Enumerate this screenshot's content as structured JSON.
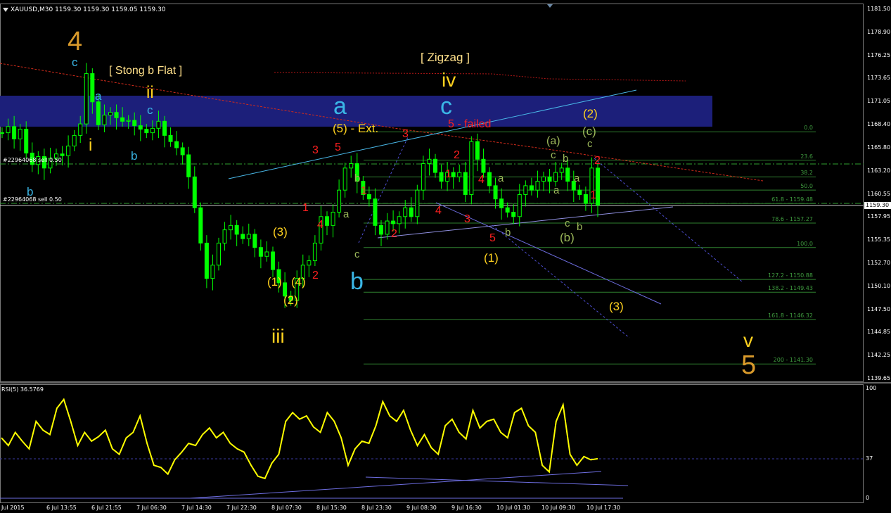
{
  "header": {
    "symbol_line": "XAUUSD,M30 1159.30 1159.30 1159.05 1159.30"
  },
  "price_axis": {
    "ticks": [
      "1181.50",
      "1178.90",
      "1176.25",
      "1173.65",
      "1171.05",
      "1168.40",
      "1165.80",
      "1163.20",
      "1160.55",
      "1157.95",
      "1155.35",
      "1152.70",
      "1150.10",
      "1147.50",
      "1144.85",
      "1142.25",
      "1139.65"
    ],
    "current_price": "1159.30"
  },
  "time_axis": {
    "ticks": [
      "Jul 2015",
      "6 Jul 13:55",
      "6 Jul 21:55",
      "7 Jul 06:30",
      "7 Jul 14:30",
      "7 Jul 22:30",
      "8 Jul 07:30",
      "8 Jul 15:30",
      "8 Jul 23:30",
      "9 Jul 08:30",
      "9 Jul 16:30",
      "10 Jul 01:30",
      "10 Jul 09:30",
      "10 Jul 17:30"
    ]
  },
  "orders": {
    "order1": "#22964068 sell 0.50",
    "order2": "#22964068 sell 0.50"
  },
  "fib_levels": [
    "0.0",
    "23.6",
    "38.2",
    "50.0",
    "61.8 - 1159.48",
    "78.6 - 1157.27",
    "100.0",
    "127.2 - 1150.88",
    "138.2 - 1149.43",
    "161.8 - 1146.32",
    "200 - 1141.30"
  ],
  "rsi": {
    "label": "RSI(5) 36.5769",
    "scale": [
      "100",
      "37",
      "0"
    ]
  },
  "annotations": {
    "strong_b_flat": "[ Stong b Flat ]",
    "zigzag": "[ Zigzag ]",
    "ext": "(5) - Ext.",
    "failed": "5 - failed",
    "wave4_big": "4",
    "wave5_big": "5",
    "wave_v": "v",
    "wave_iv": "iv",
    "wave_iii": "iii",
    "wave_ii": "ii",
    "wave_i": "i",
    "wave_a_blue": "a",
    "wave_b_blue": "b",
    "wave_c_blue": "c",
    "paren_1": "(1)",
    "paren_2": "(2)",
    "paren_3": "(3)",
    "paren_4": "(4)",
    "paren_a": "(a)",
    "paren_b": "(b)",
    "paren_c": "(c)",
    "n1": "1",
    "n2": "2",
    "n3": "3",
    "n4": "4",
    "n5": "5",
    "la": "a",
    "lb": "b",
    "lc": "c"
  },
  "colors": {
    "bull": "#00ff00",
    "bear": "#00ff00",
    "zone": "#1c1f7a",
    "rsi_line": "#ffff00",
    "gold": "#d99a2b",
    "yellow": "#ffd21f",
    "cyan": "#3ab6e6",
    "red": "#ff2020",
    "olive": "#9cb85a"
  },
  "chart_data": {
    "type": "candlestick",
    "symbol": "XAUUSD",
    "timeframe": "M30",
    "ylim": [
      1139.65,
      1181.5
    ],
    "rsi_period": 5,
    "rsi_last": 36.5769,
    "close_path": [
      1167.5,
      1168.2,
      1166.8,
      1167.9,
      1165.2,
      1163.9,
      1164.8,
      1163.5,
      1164.6,
      1165.1,
      1164.9,
      1166.0,
      1167.2,
      1168.5,
      1174.2,
      1171.0,
      1168.4,
      1169.5,
      1169.8,
      1169.2,
      1168.8,
      1168.9,
      1168.3,
      1167.9,
      1167.5,
      1168.0,
      1168.8,
      1167.2,
      1166.5,
      1165.8,
      1165.0,
      1162.5,
      1159.0,
      1155.0,
      1151.0,
      1152.5,
      1155.0,
      1156.5,
      1157.0,
      1156.0,
      1155.5,
      1156.0,
      1154.5,
      1153.5,
      1154.0,
      1152.0,
      1150.5,
      1149.0,
      1148.5,
      1151.0,
      1152.5,
      1153.0,
      1155.0,
      1158.0,
      1157.0,
      1158.5,
      1161.0,
      1163.5,
      1164.0,
      1162.0,
      1160.5,
      1160.0,
      1157.0,
      1156.0,
      1157.5,
      1157.2,
      1158.0,
      1159.0,
      1158.0,
      1161.0,
      1164.0,
      1164.5,
      1163.0,
      1162.0,
      1163.0,
      1162.5,
      1163.0,
      1160.5,
      1166.5,
      1164.5,
      1163.0,
      1161.5,
      1160.0,
      1159.0,
      1158.5,
      1158.0,
      1160.5,
      1161.5,
      1161.0,
      1162.0,
      1162.5,
      1162.0,
      1163.0,
      1163.5,
      1162.0,
      1161.0,
      1160.5,
      1159.5,
      1163.5,
      1159.3
    ],
    "rsi_path": [
      55,
      48,
      60,
      52,
      45,
      70,
      62,
      58,
      82,
      90,
      70,
      48,
      60,
      52,
      56,
      62,
      45,
      40,
      55,
      60,
      75,
      50,
      30,
      28,
      22,
      35,
      42,
      50,
      48,
      58,
      64,
      55,
      60,
      50,
      45,
      42,
      30,
      20,
      18,
      32,
      40,
      70,
      78,
      72,
      75,
      65,
      60,
      78,
      70,
      55,
      30,
      45,
      52,
      50,
      66,
      88,
      75,
      70,
      80,
      62,
      48,
      58,
      46,
      40,
      66,
      72,
      60,
      54,
      80,
      64,
      70,
      72,
      60,
      55,
      78,
      82,
      66,
      60,
      30,
      24,
      70,
      85,
      40,
      30,
      38,
      35,
      36
    ],
    "fib_retracement": [
      {
        "level": "0.0",
        "price": 1167.6
      },
      {
        "level": "23.6",
        "price": 1164.4
      },
      {
        "level": "38.2",
        "price": 1162.5
      },
      {
        "level": "50.0",
        "price": 1161.0
      },
      {
        "level": "61.8",
        "price": 1159.48
      },
      {
        "level": "78.6",
        "price": 1157.27
      },
      {
        "level": "100.0",
        "price": 1154.5
      },
      {
        "level": "127.2",
        "price": 1150.88
      },
      {
        "level": "138.2",
        "price": 1149.43
      },
      {
        "level": "161.8",
        "price": 1146.32
      },
      {
        "level": "200",
        "price": 1141.3
      }
    ]
  }
}
